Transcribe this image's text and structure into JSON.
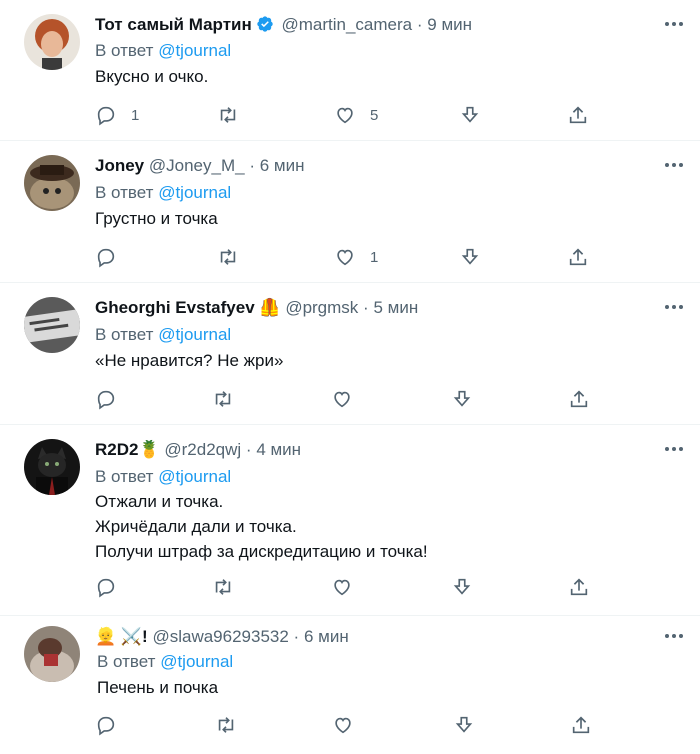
{
  "tweets": [
    {
      "name": "Тот самый Мартин",
      "handle": "@martin_camera",
      "sep": "·",
      "time": "9 мин",
      "reply_prefix": "В ответ",
      "reply_handle": "@tjournal",
      "lines": [
        "Вкусно и очко."
      ],
      "replies": "1",
      "retweets": "",
      "likes": "5",
      "verified": true
    },
    {
      "name": "Joney",
      "handle": "@Joney_M_",
      "sep": "·",
      "time": "6 мин",
      "reply_prefix": "В ответ",
      "reply_handle": "@tjournal",
      "lines": [
        "Грустно и точка"
      ],
      "replies": "",
      "retweets": "",
      "likes": "1"
    },
    {
      "name": "Gheorghi Evstafyev",
      "emoji": "🦺",
      "handle": "@prgmsk",
      "sep": "·",
      "time": "5 мин",
      "reply_prefix": "В ответ",
      "reply_handle": "@tjournal",
      "lines": [
        "«Не нравится? Не жри»"
      ],
      "replies": "",
      "retweets": "",
      "likes": ""
    },
    {
      "name": "R2D2",
      "emoji": "🍍",
      "handle": "@r2d2qwj",
      "sep": "·",
      "time": "4 мин",
      "reply_prefix": "В ответ",
      "reply_handle": "@tjournal",
      "lines": [
        "Отжали и точка.",
        "Жричёдали дали и точка.",
        "Получи штраф за дискредитацию и точка!"
      ],
      "replies": "",
      "retweets": "",
      "likes": ""
    },
    {
      "name": "👱 ⚔️!",
      "handle": "@slawa96293532",
      "sep": "·",
      "time": "6 мин",
      "reply_prefix": "В ответ",
      "reply_handle": "@tjournal",
      "lines": [
        "Печень и почка"
      ],
      "replies": "",
      "retweets": "",
      "likes": ""
    }
  ],
  "icons": {
    "reply": "reply-icon",
    "retweet": "retweet-icon",
    "like": "like-icon",
    "download": "download-icon",
    "share": "share-icon",
    "more": "more-icon",
    "verified": "verified-badge-icon"
  },
  "colors": {
    "text": "#0f1419",
    "secondary": "#536471",
    "link": "#1d9bf0",
    "divider": "#eff3f4"
  }
}
